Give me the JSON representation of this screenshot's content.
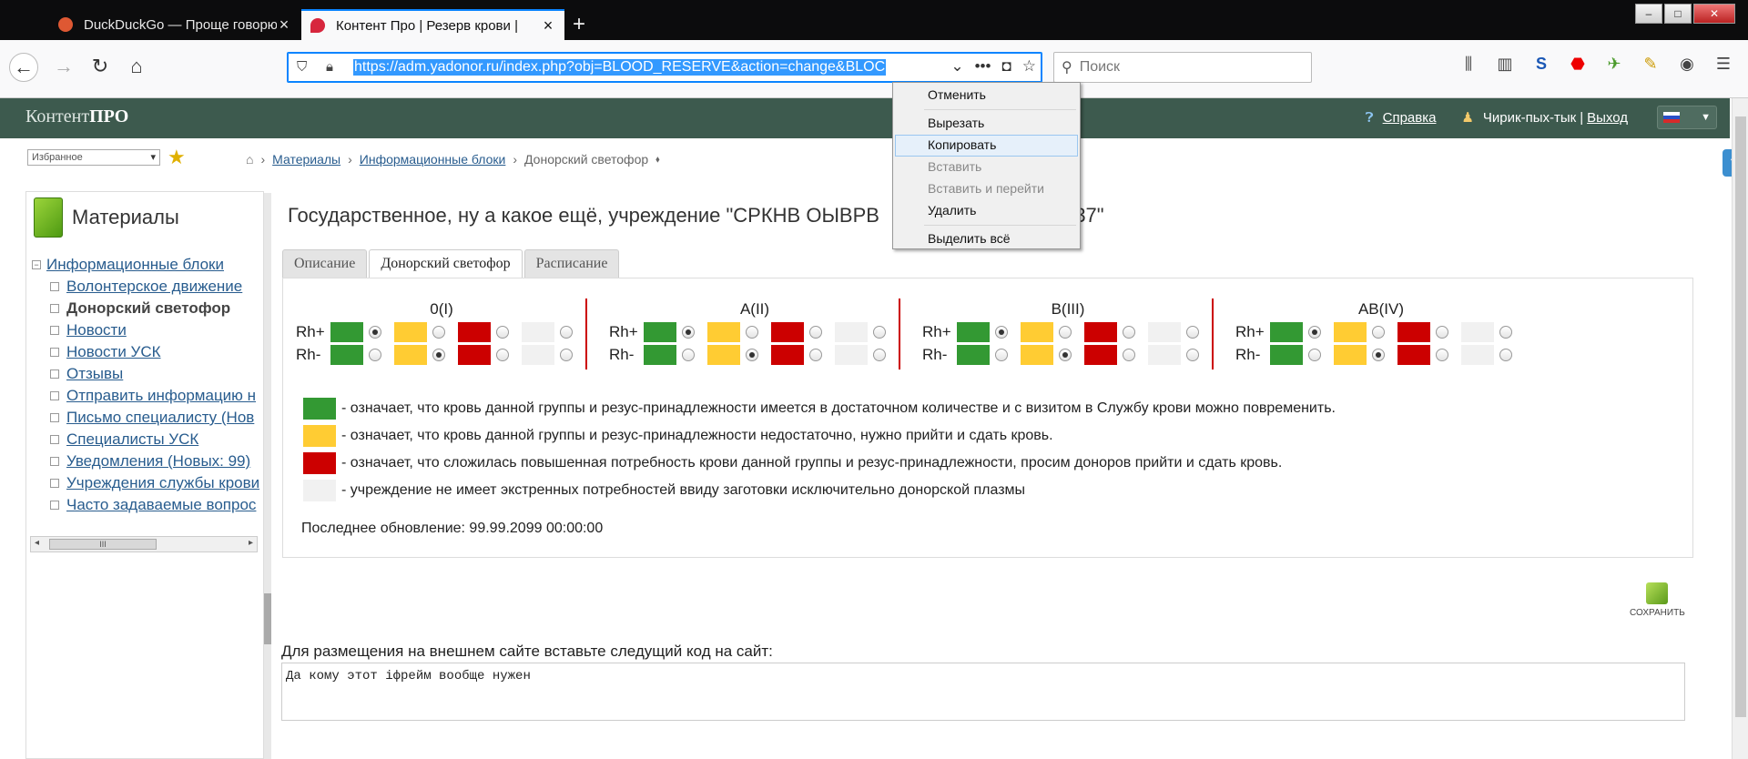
{
  "browser": {
    "tabs": [
      {
        "title": "DuckDuckGo — Проще говорю",
        "favicon_color": "#de5833"
      },
      {
        "title": "Контент Про | Резерв крови |",
        "favicon_color": "#d7263d"
      }
    ],
    "url": "https://adm.yadonor.ru/index.php?obj=BLOOD_RESERVE&action=change&BLOC",
    "search_placeholder": "Поиск"
  },
  "context_menu": {
    "items": [
      {
        "label": "Отменить",
        "state": "normal"
      },
      {
        "label": "Вырезать",
        "state": "normal"
      },
      {
        "label": "Копировать",
        "state": "highlighted"
      },
      {
        "label": "Вставить",
        "state": "disabled"
      },
      {
        "label": "Вставить и перейти",
        "state": "disabled"
      },
      {
        "label": "Удалить",
        "state": "normal"
      },
      {
        "label": "Выделить всё",
        "state": "normal"
      }
    ]
  },
  "header": {
    "logo_light": "Контент",
    "logo_bold": "ПРО",
    "help": "Справка",
    "user": "Чирик-пых-тык",
    "logout": "Выход"
  },
  "favorites": {
    "selected": "Избранное"
  },
  "breadcrumb": [
    "Материалы",
    "Информационные блоки",
    "Донорский светофор"
  ],
  "sidebar": {
    "title": "Материалы",
    "root": "Информационные блоки",
    "items": [
      "Волонтерское движение",
      "Донорский светофор",
      "Новости",
      "Новости УСК",
      "Отзывы",
      "Отправить информацию н",
      "Письмо специалисту (Нов",
      "Специалисты УСК",
      "Уведомления (Новых: 99)",
      "Учреждения службы крови",
      "Часто задаваемые вопрос"
    ]
  },
  "main": {
    "title": "Государственное, ну а какое ещё, учреждение \"СРКНВ ОЫВРВ",
    "title_tail": "Р №37\"",
    "tabs": [
      "Описание",
      "Донорский светофор",
      "Расписание"
    ],
    "active_tab": 1,
    "groups": [
      {
        "name": "0(I)",
        "rh_plus": 0,
        "rh_minus": 1
      },
      {
        "name": "A(II)",
        "rh_plus": 0,
        "rh_minus": 1
      },
      {
        "name": "B(III)",
        "rh_plus": 0,
        "rh_minus": 1
      },
      {
        "name": "AB(IV)",
        "rh_plus": 0,
        "rh_minus": 1
      }
    ],
    "rh_labels": [
      "Rh+",
      "Rh-"
    ],
    "legend": [
      {
        "color": "#339933",
        "text": "- означает, что кровь данной группы и резус-принадлежности имеется в достаточном количестве и с визитом в Службу крови можно повременить."
      },
      {
        "color": "#ffcc33",
        "text": "- означает, что кровь данной группы и резус-принадлежности недостаточно, нужно прийти и сдать кровь."
      },
      {
        "color": "#cc0000",
        "text": "- означает, что сложилась повышенная потребность крови данной группы и резус-принадлежности, просим доноров прийти и сдать кровь."
      },
      {
        "color": "#f1f1f1",
        "text": "- учреждение не имеет экстренных потребностей ввиду заготовки исключительно донорской плазмы"
      }
    ],
    "updated": "Последнее обновление: 99.99.2099 00:00:00",
    "save": "СОХРАНИТЬ",
    "embed_label": "Для размещения на внешнем сайте вставьте следущий код на сайт:",
    "embed_code": "Да кому этот іфрейм вообще нужен"
  }
}
